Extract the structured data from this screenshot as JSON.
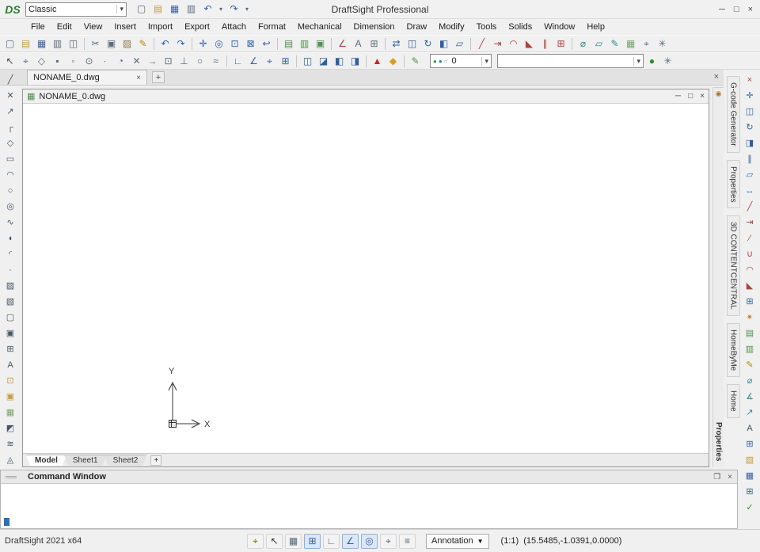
{
  "window": {
    "logo_text": "DS",
    "title": "DraftSight Professional",
    "workspace": {
      "value": "Classic",
      "caret": "▾"
    },
    "controls": {
      "minimize": "─",
      "maximize": "□",
      "close": "×"
    }
  },
  "quick_access": [
    {
      "name": "new-file",
      "glyph": "▢",
      "color": "#5a6b7d"
    },
    {
      "name": "open-file",
      "glyph": "▤",
      "color": "#c89b3c"
    },
    {
      "name": "save",
      "glyph": "▦",
      "color": "#3a5fa0"
    },
    {
      "name": "print",
      "glyph": "▥",
      "color": "#5a6b7d"
    },
    {
      "name": "undo",
      "glyph": "↶",
      "color": "#2e5fa3"
    },
    {
      "name": "undo-options",
      "glyph": "▾",
      "color": "#5a6b7d",
      "narrow": true
    },
    {
      "name": "redo",
      "glyph": "↷",
      "color": "#2e5fa3"
    },
    {
      "name": "redo-options",
      "glyph": "▾",
      "color": "#5a6b7d",
      "narrow": true
    }
  ],
  "menu": {
    "items": [
      "File",
      "Edit",
      "View",
      "Insert",
      "Import",
      "Export",
      "Attach",
      "Format",
      "Mechanical",
      "Dimension",
      "Draw",
      "Modify",
      "Tools",
      "Solids",
      "Window",
      "Help"
    ]
  },
  "toolbar_main": {
    "items": [
      {
        "name": "new",
        "glyph": "▢",
        "color": "#5a6b7d"
      },
      {
        "name": "open",
        "glyph": "▤",
        "color": "#c89b3c"
      },
      {
        "name": "save",
        "glyph": "▦",
        "color": "#3a5fa0"
      },
      {
        "name": "print",
        "glyph": "▥",
        "color": "#5a6b7d"
      },
      {
        "name": "print-preview",
        "glyph": "◫",
        "color": "#5a6b7d"
      },
      {
        "sep": true
      },
      {
        "name": "cut",
        "glyph": "✂",
        "color": "#5a6b7d"
      },
      {
        "name": "copy",
        "glyph": "▣",
        "color": "#5a6b7d"
      },
      {
        "name": "paste",
        "glyph": "▨",
        "color": "#8a7a4a"
      },
      {
        "name": "properties-painter",
        "glyph": "✎",
        "color": "#b58900"
      },
      {
        "sep": true
      },
      {
        "name": "undo",
        "glyph": "↶",
        "color": "#2e5fa3"
      },
      {
        "name": "redo",
        "glyph": "↷",
        "color": "#2e5fa3"
      },
      {
        "sep": true
      },
      {
        "name": "pan",
        "glyph": "✛",
        "color": "#2e5fa3"
      },
      {
        "name": "zoom-dynamic",
        "glyph": "◎",
        "color": "#2e5fa3"
      },
      {
        "name": "zoom-window",
        "glyph": "⊡",
        "color": "#2e5fa3"
      },
      {
        "name": "zoom-fit",
        "glyph": "⊠",
        "color": "#2e5fa3"
      },
      {
        "name": "zoom-previous",
        "glyph": "↩",
        "color": "#2e5fa3"
      },
      {
        "sep": true
      },
      {
        "name": "layers-manager",
        "glyph": "▤",
        "color": "#4f8f4f"
      },
      {
        "name": "layer-states",
        "glyph": "▥",
        "color": "#4f8f4f"
      },
      {
        "name": "properties-palette",
        "glyph": "▣",
        "color": "#4f8f4f"
      },
      {
        "sep": true
      },
      {
        "name": "dimension-style",
        "glyph": "∠",
        "color": "#b0413e"
      },
      {
        "name": "text-style",
        "glyph": "A",
        "color": "#5a6b7d"
      },
      {
        "name": "table-style",
        "glyph": "⊞",
        "color": "#5a6b7d"
      },
      {
        "sep": true
      },
      {
        "name": "move",
        "glyph": "⇄",
        "color": "#2e5fa3"
      },
      {
        "name": "copy-entity",
        "glyph": "◫",
        "color": "#2e5fa3"
      },
      {
        "name": "rotate",
        "glyph": "↻",
        "color": "#2e5fa3"
      },
      {
        "name": "mirror",
        "glyph": "◧",
        "color": "#2e5fa3"
      },
      {
        "name": "scale",
        "glyph": "▱",
        "color": "#2e5fa3"
      },
      {
        "sep": true
      },
      {
        "name": "trim",
        "glyph": "╱",
        "color": "#b0413e"
      },
      {
        "name": "extend",
        "glyph": "⇥",
        "color": "#b0413e"
      },
      {
        "name": "fillet",
        "glyph": "◠",
        "color": "#b0413e"
      },
      {
        "name": "chamfer",
        "glyph": "◣",
        "color": "#b0413e"
      },
      {
        "name": "offset",
        "glyph": "∥",
        "color": "#b0413e"
      },
      {
        "name": "pattern",
        "glyph": "⊞",
        "color": "#b0413e"
      },
      {
        "sep": true
      },
      {
        "name": "measure",
        "glyph": "⌀",
        "color": "#2e8b8b"
      },
      {
        "name": "area",
        "glyph": "▱",
        "color": "#2e8b8b"
      },
      {
        "name": "note",
        "glyph": "✎",
        "color": "#2e8b8b"
      },
      {
        "name": "image-attach",
        "glyph": "▦",
        "color": "#7aa36a"
      },
      {
        "name": "esnap-settings",
        "glyph": "⌖",
        "color": "#5a6b7d"
      },
      {
        "name": "options",
        "glyph": "✳",
        "color": "#5a6b7d"
      }
    ]
  },
  "toolbar_secondary": {
    "items": [
      {
        "name": "select",
        "glyph": "↖",
        "color": "#444444"
      },
      {
        "name": "esnap",
        "glyph": "⌖",
        "color": "#5a6b7d"
      },
      {
        "name": "snap-from",
        "glyph": "◇",
        "color": "#5a6b7d"
      },
      {
        "name": "endpoint",
        "glyph": "▪",
        "color": "#5a6b7d"
      },
      {
        "name": "midpoint",
        "glyph": "◦",
        "color": "#5a6b7d"
      },
      {
        "name": "center",
        "glyph": "⊙",
        "color": "#5a6b7d"
      },
      {
        "name": "node",
        "glyph": "∙",
        "color": "#5a6b7d"
      },
      {
        "name": "quadrant",
        "glyph": "◔",
        "color": "#5a6b7d"
      },
      {
        "name": "intersection",
        "glyph": "✕",
        "color": "#5a6b7d"
      },
      {
        "name": "extension",
        "glyph": "→",
        "color": "#5a6b7d"
      },
      {
        "name": "insertion",
        "glyph": "⊡",
        "color": "#5a6b7d"
      },
      {
        "name": "perpendicular",
        "glyph": "⊥",
        "color": "#5a6b7d"
      },
      {
        "name": "tangent",
        "glyph": "○",
        "color": "#5a6b7d"
      },
      {
        "name": "nearest",
        "glyph": "≈",
        "color": "#5a6b7d"
      },
      {
        "sep": true
      },
      {
        "name": "ortho",
        "glyph": "∟",
        "color": "#3a5fa0"
      },
      {
        "name": "polar",
        "glyph": "∠",
        "color": "#3a5fa0"
      },
      {
        "name": "etrack",
        "glyph": "⌖",
        "color": "#3a5fa0"
      },
      {
        "name": "grid",
        "glyph": "⊞",
        "color": "#3a5fa0"
      },
      {
        "sep": true
      },
      {
        "name": "draw-order-front",
        "glyph": "◫",
        "color": "#2e5fa3"
      },
      {
        "name": "draw-order-back",
        "glyph": "◪",
        "color": "#2e5fa3"
      },
      {
        "name": "hide",
        "glyph": "◧",
        "color": "#2e5fa3"
      },
      {
        "name": "shade",
        "glyph": "◨",
        "color": "#2e5fa3"
      },
      {
        "sep": true
      },
      {
        "name": "warning",
        "glyph": "▲",
        "color": "#cc2222"
      },
      {
        "name": "highlight",
        "glyph": "◆",
        "color": "#d4a017"
      },
      {
        "sep": true
      },
      {
        "name": "make-layer-current",
        "glyph": "✎",
        "color": "#4f8f4f"
      }
    ],
    "layer_combo": {
      "dots": [
        {
          "name": "layer-on",
          "glyph": "●",
          "color": "#3f9b3f"
        },
        {
          "name": "layer-thaw",
          "glyph": "●",
          "color": "#2e8b8b"
        },
        {
          "name": "layer-unlock",
          "glyph": "○",
          "color": "#888888"
        }
      ],
      "value": "0",
      "caret": "▾"
    },
    "style_combo": {
      "value": "",
      "caret": "▾"
    },
    "trailing": [
      {
        "name": "line-color",
        "glyph": "●",
        "color": "#2e8b2e"
      },
      {
        "name": "settings",
        "glyph": "✳",
        "color": "#5a6b7d"
      }
    ]
  },
  "doc_tabs": {
    "active_tab": {
      "label": "NONAME_0.dwg",
      "close": "×"
    },
    "add_tab": "+",
    "bar_close": "×"
  },
  "left_toolbar": {
    "items": [
      {
        "name": "line",
        "glyph": "╱",
        "color": "#445566"
      },
      {
        "name": "infinite-line",
        "glyph": "✕",
        "color": "#445566"
      },
      {
        "name": "ray",
        "glyph": "↗",
        "color": "#445566"
      },
      {
        "name": "polyline",
        "glyph": "┌",
        "color": "#445566"
      },
      {
        "name": "polygon",
        "glyph": "◇",
        "color": "#445566"
      },
      {
        "name": "rectangle",
        "glyph": "▭",
        "color": "#445566"
      },
      {
        "name": "arc",
        "glyph": "◠",
        "color": "#445566"
      },
      {
        "name": "circle",
        "glyph": "○",
        "color": "#445566"
      },
      {
        "name": "ring",
        "glyph": "◎",
        "color": "#445566"
      },
      {
        "name": "spline",
        "glyph": "∿",
        "color": "#445566"
      },
      {
        "name": "ellipse",
        "glyph": "◖",
        "color": "#445566"
      },
      {
        "name": "ellipse-arc",
        "glyph": "◜",
        "color": "#445566"
      },
      {
        "name": "point",
        "glyph": "∙",
        "color": "#445566"
      },
      {
        "name": "hatch",
        "glyph": "▨",
        "color": "#445566"
      },
      {
        "name": "gradient",
        "glyph": "▧",
        "color": "#445566"
      },
      {
        "name": "boundary",
        "glyph": "▢",
        "color": "#445566"
      },
      {
        "name": "region",
        "glyph": "▣",
        "color": "#445566"
      },
      {
        "name": "table",
        "glyph": "⊞",
        "color": "#445566"
      },
      {
        "name": "text",
        "glyph": "A",
        "color": "#445566"
      },
      {
        "name": "insert-block",
        "glyph": "⊡",
        "color": "#c89b3c"
      },
      {
        "name": "make-block",
        "glyph": "▣",
        "color": "#c89b3c"
      },
      {
        "name": "attach-image",
        "glyph": "▦",
        "color": "#7aa36a"
      },
      {
        "name": "wipeout",
        "glyph": "◩",
        "color": "#445566"
      },
      {
        "name": "revision-cloud",
        "glyph": "≋",
        "color": "#445566"
      },
      {
        "name": "3d-face",
        "glyph": "◬",
        "color": "#445566"
      }
    ]
  },
  "right_toolbar": {
    "items": [
      {
        "name": "erase",
        "glyph": "×",
        "color": "#b0413e"
      },
      {
        "name": "move",
        "glyph": "✛",
        "color": "#2e5fa3"
      },
      {
        "name": "copy",
        "glyph": "◫",
        "color": "#2e5fa3"
      },
      {
        "name": "rotate",
        "glyph": "↻",
        "color": "#2e5fa3"
      },
      {
        "name": "mirror",
        "glyph": "◨",
        "color": "#2e5fa3"
      },
      {
        "name": "offset",
        "glyph": "∥",
        "color": "#2e5fa3"
      },
      {
        "name": "scale",
        "glyph": "▱",
        "color": "#2e5fa3"
      },
      {
        "name": "stretch",
        "glyph": "↔",
        "color": "#2e5fa3"
      },
      {
        "name": "trim",
        "glyph": "╱",
        "color": "#b0413e"
      },
      {
        "name": "extend",
        "glyph": "⇥",
        "color": "#b0413e"
      },
      {
        "name": "split",
        "glyph": "∕",
        "color": "#b0413e"
      },
      {
        "name": "weld",
        "glyph": "∪",
        "color": "#b0413e"
      },
      {
        "name": "fillet",
        "glyph": "◠",
        "color": "#b0413e"
      },
      {
        "name": "chamfer",
        "glyph": "◣",
        "color": "#b0413e"
      },
      {
        "name": "pattern",
        "glyph": "⊞",
        "color": "#2e5fa3"
      },
      {
        "name": "explode",
        "glyph": "✴",
        "color": "#c2701e"
      },
      {
        "name": "properties",
        "glyph": "▤",
        "color": "#4f8f4f"
      },
      {
        "name": "layers",
        "glyph": "▥",
        "color": "#4f8f4f"
      },
      {
        "name": "match-properties",
        "glyph": "✎",
        "color": "#b58900"
      },
      {
        "name": "measure",
        "glyph": "⌀",
        "color": "#2e8b8b"
      },
      {
        "name": "smart-dimension",
        "glyph": "∡",
        "color": "#2e8b8b"
      },
      {
        "name": "leader",
        "glyph": "↗",
        "color": "#2e8b8b"
      },
      {
        "name": "mtext",
        "glyph": "A",
        "color": "#445566"
      },
      {
        "name": "insert-table",
        "glyph": "⊞",
        "color": "#3a5fa0"
      },
      {
        "name": "hatch",
        "glyph": "▨",
        "color": "#c89b3c"
      },
      {
        "name": "grid-display",
        "glyph": "▦",
        "color": "#3a5fa0"
      },
      {
        "name": "cell-style",
        "glyph": "⊞",
        "color": "#3a5fa0"
      },
      {
        "name": "check",
        "glyph": "✓",
        "color": "#2e8b2e"
      }
    ]
  },
  "side_tabs": {
    "items": [
      {
        "name": "tab-gcode-generator",
        "label": "G-code Generator"
      },
      {
        "name": "tab-properties",
        "label": "Properties"
      },
      {
        "name": "tab-3d-contentcentral",
        "label": "3D CONTENTCENTRAL"
      },
      {
        "name": "tab-homebyme",
        "label": "HomeByMe"
      },
      {
        "name": "tab-home",
        "label": "Home"
      }
    ]
  },
  "properties_strip": {
    "pin": "◉",
    "label": "Properties"
  },
  "child_window": {
    "icon": "▦",
    "title": "NONAME_0.dwg",
    "controls": {
      "minimize": "─",
      "maximize": "□",
      "close": "×"
    }
  },
  "ucs": {
    "x_label": "X",
    "y_label": "Y"
  },
  "sheet_tabs": {
    "items": [
      "Model",
      "Sheet1",
      "Sheet2"
    ],
    "add": "+"
  },
  "command_window": {
    "title": "Command Window",
    "float": "❐",
    "close": "×"
  },
  "status_bar": {
    "left_text": "DraftSight 2021 x64",
    "toggles": [
      {
        "name": "pointer-mode",
        "glyph": "⌖",
        "color": "#7a6a00"
      },
      {
        "name": "selection-settings",
        "glyph": "↖",
        "color": "#333333"
      },
      {
        "name": "snap",
        "glyph": "▦",
        "color": "#556677"
      },
      {
        "name": "grid",
        "glyph": "⊞",
        "color": "#3a5fa0",
        "on": true
      },
      {
        "name": "ortho",
        "glyph": "∟",
        "color": "#556677"
      },
      {
        "name": "polar",
        "glyph": "∠",
        "color": "#3a5fa0",
        "on": true
      },
      {
        "name": "esnap",
        "glyph": "◎",
        "color": "#3a5fa0",
        "on": true
      },
      {
        "name": "etrack",
        "glyph": "⌖",
        "color": "#556677"
      },
      {
        "name": "lineweight",
        "glyph": "≡",
        "color": "#556677"
      }
    ],
    "annotation": {
      "label": "Annotation",
      "caret": "▼"
    },
    "coordinates": "(1:1)  (15.5485,-1.0391,0.0000)"
  }
}
